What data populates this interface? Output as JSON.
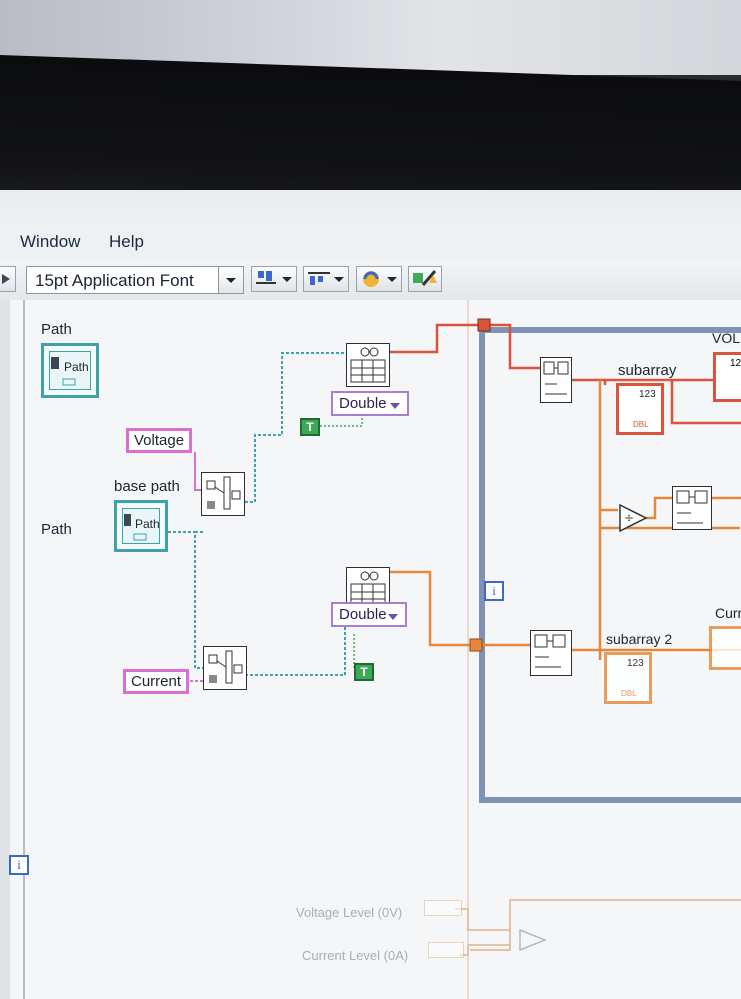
{
  "menu": {
    "items": [
      "Window",
      "Help"
    ]
  },
  "toolbar": {
    "font_select": "15pt Application Font",
    "buttons": [
      "align-objects",
      "distribute-objects",
      "reorder",
      "cleanup-diagram"
    ]
  },
  "diagram": {
    "path_label": "Path",
    "path_terminal_text": "Path",
    "voltage_label": "Voltage",
    "base_path_label": "base path",
    "base_path_terminal_text": "Path",
    "current_label": "Current",
    "double_1": "Double",
    "double_2": "Double",
    "true_1": "T",
    "true_2": "T",
    "loop_iteration": "i",
    "outer_iteration": "i",
    "subarray_label": "subarray",
    "subarray2_label": "subarray 2",
    "vol_label": "VOL",
    "curr_label": "Curr",
    "voltage_level_label": "Voltage Level (0V)",
    "current_level_label": "Current Level (0A)",
    "indicator_123": "123",
    "dbl_tag": "DBL",
    "colors": {
      "path_wire": "#3fa2ab",
      "string_wire": "#d96fd0",
      "array_wire_orange": "#e8863a",
      "array_wire_red": "#d9533d",
      "loop_border": "#8093b5"
    }
  }
}
